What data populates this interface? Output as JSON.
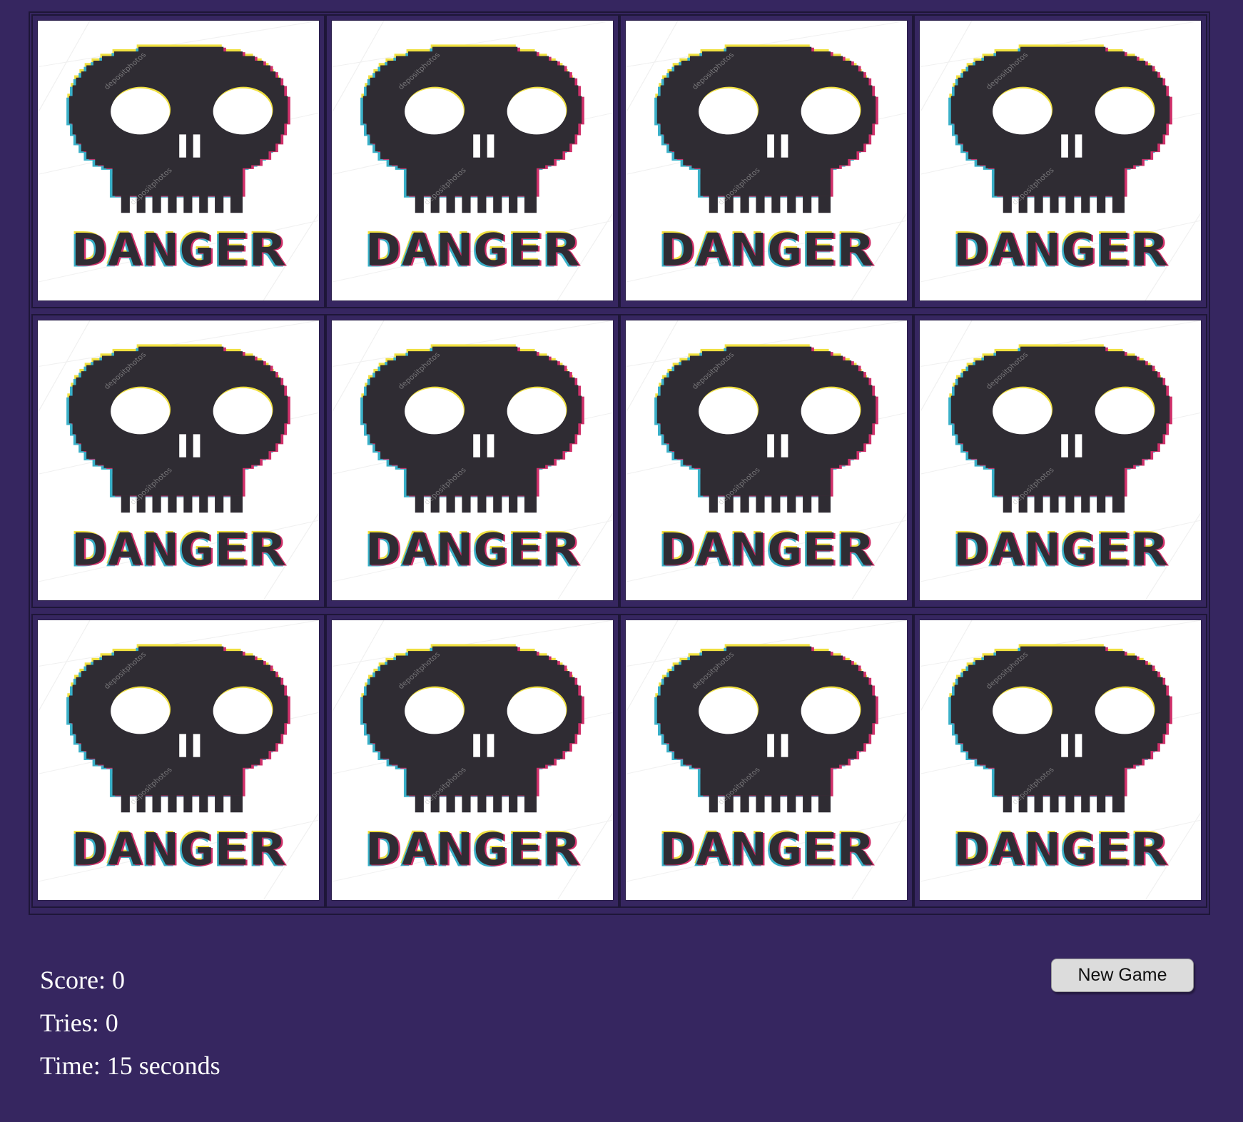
{
  "board": {
    "rows": 3,
    "cols": 4,
    "card_face": "danger-skull-icon",
    "card_label": "DANGER",
    "watermark": "depositphotos"
  },
  "stats": {
    "score_label": "Score: ",
    "score_value": "0",
    "tries_label": "Tries: ",
    "tries_value": "0",
    "time_label": "Time: ",
    "time_value": "15",
    "time_unit": " seconds"
  },
  "controls": {
    "new_game_label": "New Game"
  },
  "colors": {
    "background": "#362660",
    "card": "#ffffff",
    "skull": "#2f2c33"
  }
}
